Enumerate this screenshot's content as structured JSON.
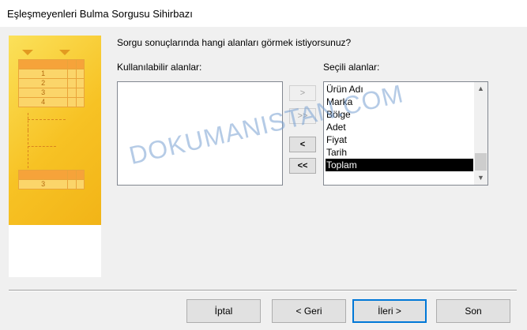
{
  "window": {
    "title": "Eşleşmeyenleri Bulma Sorgusu Sihirbazı"
  },
  "prompt": "Sorgu sonuçlarında hangi alanları görmek istiyorsunuz?",
  "available": {
    "label": "Kullanılabilir alanlar:",
    "items": []
  },
  "selected": {
    "label": "Seçili alanlar:",
    "items": [
      "Ürün Adı",
      "Marka",
      "Bölge",
      "Adet",
      "Fiyat",
      "Tarih",
      "Toplam"
    ],
    "highlighted": "Toplam"
  },
  "move_buttons": {
    "add_one": ">",
    "add_all": ">>",
    "remove_one": "<",
    "remove_all": "<<"
  },
  "illustration": {
    "top_rows": [
      "1",
      "2",
      "3",
      "4"
    ],
    "bottom_row": "3"
  },
  "footer": {
    "cancel": "İptal",
    "back": "< Geri",
    "next": "İleri >",
    "finish": "Son"
  },
  "watermark": "DOKUMANISTAN.COM",
  "colors": {
    "illustration_yellow": "#f7c224",
    "selection": "#000000",
    "default_button_border": "#0078d7"
  }
}
